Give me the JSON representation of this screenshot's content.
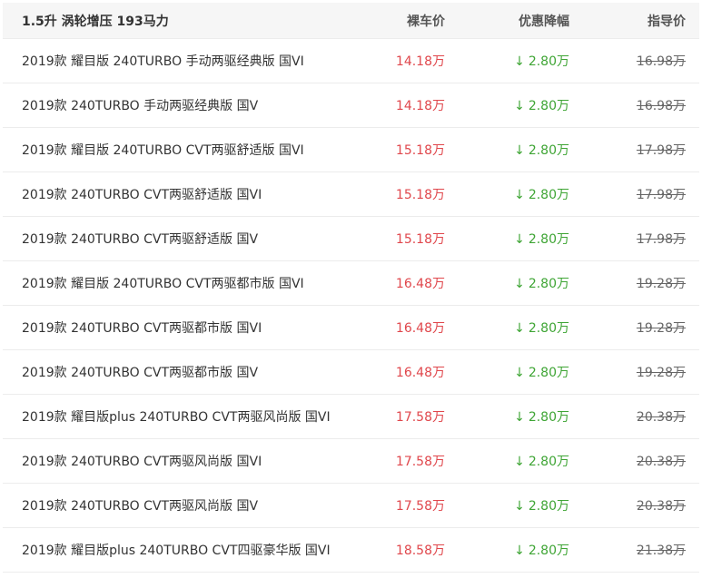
{
  "header": {
    "group_title": "1.5升 涡轮增压 193马力",
    "col_price": "裸车价",
    "col_discount": "优惠降幅",
    "col_guide": "指导价"
  },
  "icons": {
    "discount_arrow": "arrow-down-icon",
    "arrow_glyph": "↓"
  },
  "colors": {
    "price": "#e0474c",
    "discount": "#3fa535",
    "guide": "#666666"
  },
  "rows": [
    {
      "name": "2019款 耀目版 240TURBO 手动两驱经典版 国VI",
      "price": "14.18万",
      "discount": "2.80万",
      "guide": "16.98万"
    },
    {
      "name": "2019款 240TURBO 手动两驱经典版 国V",
      "price": "14.18万",
      "discount": "2.80万",
      "guide": "16.98万"
    },
    {
      "name": "2019款 耀目版 240TURBO CVT两驱舒适版 国VI",
      "price": "15.18万",
      "discount": "2.80万",
      "guide": "17.98万"
    },
    {
      "name": "2019款 240TURBO CVT两驱舒适版 国VI",
      "price": "15.18万",
      "discount": "2.80万",
      "guide": "17.98万"
    },
    {
      "name": "2019款 240TURBO CVT两驱舒适版 国V",
      "price": "15.18万",
      "discount": "2.80万",
      "guide": "17.98万"
    },
    {
      "name": "2019款 耀目版 240TURBO CVT两驱都市版 国VI",
      "price": "16.48万",
      "discount": "2.80万",
      "guide": "19.28万"
    },
    {
      "name": "2019款 240TURBO CVT两驱都市版 国VI",
      "price": "16.48万",
      "discount": "2.80万",
      "guide": "19.28万"
    },
    {
      "name": "2019款 240TURBO CVT两驱都市版 国V",
      "price": "16.48万",
      "discount": "2.80万",
      "guide": "19.28万"
    },
    {
      "name": "2019款 耀目版plus 240TURBO CVT两驱风尚版 国VI",
      "price": "17.58万",
      "discount": "2.80万",
      "guide": "20.38万"
    },
    {
      "name": "2019款 240TURBO CVT两驱风尚版 国VI",
      "price": "17.58万",
      "discount": "2.80万",
      "guide": "20.38万"
    },
    {
      "name": "2019款 240TURBO CVT两驱风尚版 国V",
      "price": "17.58万",
      "discount": "2.80万",
      "guide": "20.38万"
    },
    {
      "name": "2019款 耀目版plus 240TURBO CVT四驱豪华版 国VI",
      "price": "18.58万",
      "discount": "2.80万",
      "guide": "21.38万"
    }
  ]
}
